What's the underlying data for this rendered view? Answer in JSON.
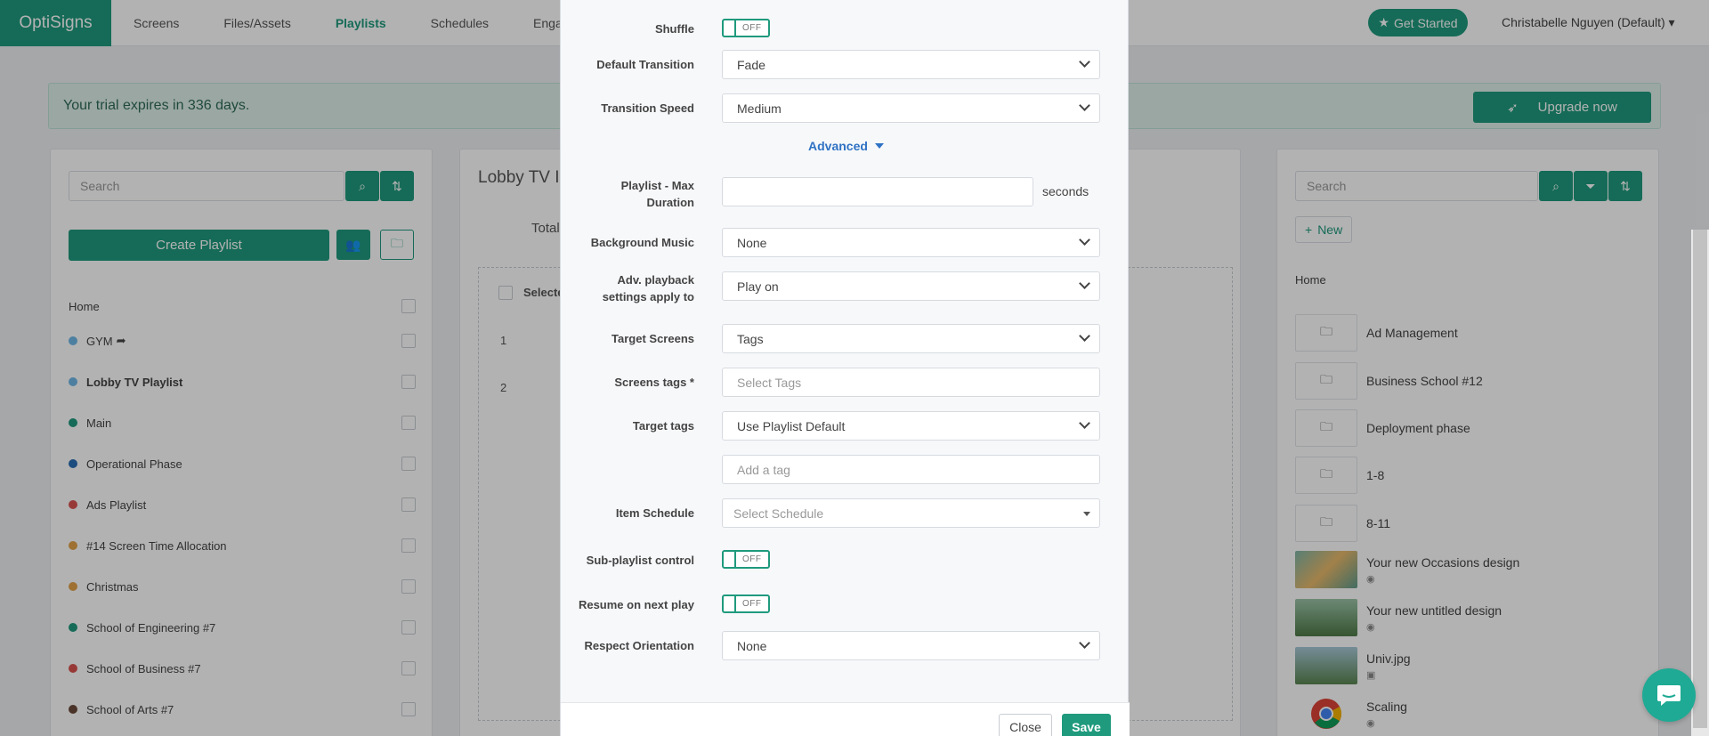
{
  "app": {
    "brand": "OptiSigns",
    "nav": [
      "Screens",
      "Files/Assets",
      "Playlists",
      "Schedules",
      "Engage"
    ],
    "get_started": "Get Started",
    "user": "Christabelle Nguyen (Default)"
  },
  "trial": {
    "message": "Your trial expires in 336 days.",
    "upgrade": "Upgrade now"
  },
  "left_panel": {
    "search_placeholder": "Search",
    "create_button": "Create Playlist",
    "home": "Home",
    "playlists": [
      {
        "name": "GYM",
        "color": "#6fb6e6"
      },
      {
        "name": "Lobby TV Playlist",
        "color": "#6fb6e6"
      },
      {
        "name": "Main",
        "color": "#1f9a7d"
      },
      {
        "name": "Operational Phase",
        "color": "#2a6db5"
      },
      {
        "name": "Ads Playlist",
        "color": "#d9534f"
      },
      {
        "name": "#14 Screen Time Allocation",
        "color": "#e3a34a"
      },
      {
        "name": "Christmas",
        "color": "#e3a34a"
      },
      {
        "name": "School of Engineering #7",
        "color": "#1f9a7d"
      },
      {
        "name": "School of Business #7",
        "color": "#d9534f"
      },
      {
        "name": "School of Arts #7",
        "color": "#6b4a3a"
      }
    ]
  },
  "mid_panel": {
    "title": "Lobby TV I",
    "total": "Total",
    "select_label": "Selecte",
    "row_numbers": [
      "1",
      "2"
    ]
  },
  "right_panel": {
    "search_placeholder": "Search",
    "new_button": "New",
    "home": "Home",
    "folders": [
      "Ad Management",
      "Business School #12",
      "Deployment phase",
      "1-8",
      "8-11"
    ],
    "assets": [
      {
        "title": "Your new Occasions design"
      },
      {
        "title": "Your new untitled design"
      },
      {
        "title": "Univ.jpg"
      },
      {
        "title": "Scaling"
      }
    ]
  },
  "modal": {
    "shuffle_label": "Shuffle",
    "shuffle_state": "OFF",
    "default_transition_label": "Default Transition",
    "default_transition_value": "Fade",
    "transition_speed_label": "Transition Speed",
    "transition_speed_value": "Medium",
    "advanced": "Advanced",
    "max_duration_label_1": "Playlist - Max",
    "max_duration_label_2": "Duration",
    "max_duration_value": "",
    "seconds": "seconds",
    "background_music_label": "Background Music",
    "background_music_value": "None",
    "adv_playback_label_1": "Adv. playback",
    "adv_playback_label_2": "settings apply to",
    "adv_playback_value": "Play on",
    "target_screens_label": "Target Screens",
    "target_screens_value": "Tags",
    "screens_tags_label": "Screens tags *",
    "screens_tags_placeholder": "Select Tags",
    "target_tags_label": "Target tags",
    "target_tags_value": "Use Playlist Default",
    "add_tag_placeholder": "Add a tag",
    "item_schedule_label": "Item Schedule",
    "item_schedule_placeholder": "Select Schedule",
    "subplaylist_label": "Sub-playlist control",
    "subplaylist_state": "OFF",
    "resume_label": "Resume on next play",
    "resume_state": "OFF",
    "respect_orientation_label": "Respect Orientation",
    "respect_orientation_value": "None",
    "close": "Close",
    "save": "Save"
  }
}
